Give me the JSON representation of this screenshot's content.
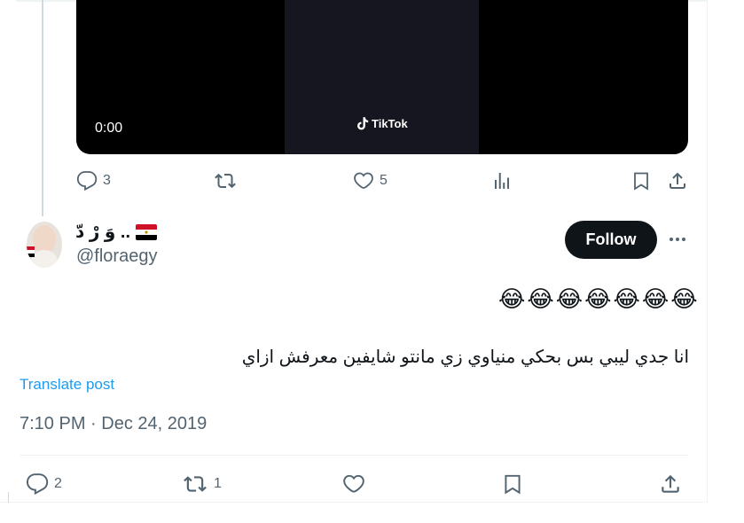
{
  "video": {
    "time": "0:00",
    "brand": "TikTok"
  },
  "top_actions": {
    "reply_count": "3",
    "retweet_count": "",
    "like_count": "5"
  },
  "tweet": {
    "author_name": "وَ رْ دّ ..",
    "author_flag": "egypt-flag-icon",
    "author_handle": "@floraegy",
    "follow_label": "Follow",
    "emojis": "😂😂😂😂😂😂😂",
    "text": "انا جدي ليبي بس بحكي منياوي زي مانتو شايفين معرفش ازاي",
    "translate_label": "Translate post",
    "timestamp": "7:10 PM · Dec 24, 2019"
  },
  "bottom_actions": {
    "reply_count": "2",
    "retweet_count": "1",
    "like_count": ""
  },
  "colors": {
    "accent": "#1d9bf0",
    "text_primary": "#0f1419",
    "text_secondary": "#536471",
    "follow_bg": "#0f1419",
    "border": "#eff3f4"
  }
}
